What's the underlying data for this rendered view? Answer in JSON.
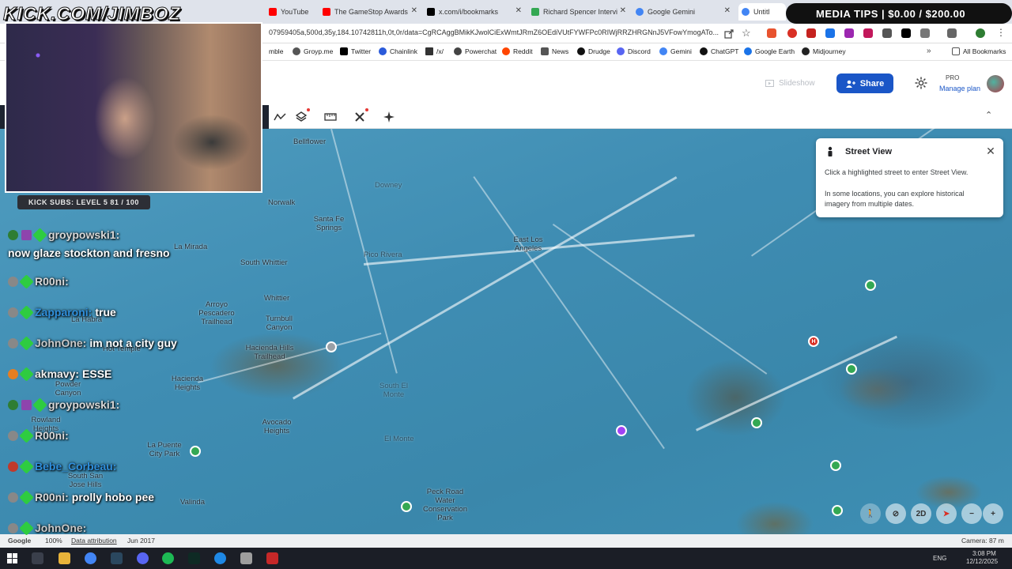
{
  "stream": {
    "watermark": "KICK.COM/JIMBOZ",
    "media_tips": "MEDIA TIPS | $0.00 / $200.00",
    "subs_bar": "KICK SUBS: LEVEL 5 81 / 100",
    "chat": [
      {
        "name": "groypowski1:",
        "msg": "",
        "color": "#d8d8d8"
      },
      {
        "name": "",
        "msg": "now glaze stockton and fresno",
        "color": "#ffffff"
      },
      {
        "name": "R00ni:",
        "msg": "",
        "color": "#d8d8d8"
      },
      {
        "name": "Zapparoni:",
        "msg": "true",
        "color": "#2f8fdc"
      },
      {
        "name": "JohnOne:",
        "msg": "im not a city guy",
        "color": "#c9c9c9"
      },
      {
        "name": "akmavy:",
        "msg": "ESSE",
        "color": "#f0f0f0"
      },
      {
        "name": "groypowski1:",
        "msg": "",
        "color": "#d8d8d8"
      },
      {
        "name": "R00ni:",
        "msg": "",
        "color": "#d8d8d8"
      },
      {
        "name": "Bebe_Corbeau:",
        "msg": "",
        "color": "#2f8fdc"
      },
      {
        "name": "R00ni:",
        "msg": "prolly hobo pee",
        "color": "#d8d8d8"
      },
      {
        "name": "JohnOne:",
        "msg": "",
        "color": "#c9c9c9"
      }
    ]
  },
  "browser": {
    "tabs": [
      {
        "label": "YouTube",
        "color": "#ff0000"
      },
      {
        "label": "The GameStop Awards",
        "color": "#ff0000"
      },
      {
        "label": "x.com/i/bookmarks",
        "color": "#000000"
      },
      {
        "label": "Richard Spencer Intervi",
        "color": "#34a853"
      },
      {
        "label": "Google Gemini",
        "color": "#4285f4"
      },
      {
        "label": "Untitl",
        "color": "#4285f4"
      }
    ],
    "url": "07959405a,500d,35y,184.10742811h,0t,0r/data=CgRCAggBMikKJwolCiExWmtJRmZ6OEdiVUtFYWFPc0RIWjRRZHRGNnJ5VFowYmogATo...",
    "bookmarks": [
      {
        "label": "mble",
        "color": "#888"
      },
      {
        "label": "Groyp.me",
        "color": "#555"
      },
      {
        "label": "Twitter",
        "color": "#000"
      },
      {
        "label": "Chainlink",
        "color": "#2a5ada"
      },
      {
        "label": "/x/",
        "color": "#333"
      },
      {
        "label": "Powerchat",
        "color": "#444"
      },
      {
        "label": "Reddit",
        "color": "#ff4500"
      },
      {
        "label": "News",
        "color": "#555"
      },
      {
        "label": "Drudge",
        "color": "#111"
      },
      {
        "label": "Discord",
        "color": "#5865f2"
      },
      {
        "label": "Gemini",
        "color": "#4285f4"
      },
      {
        "label": "ChatGPT",
        "color": "#111"
      },
      {
        "label": "Google Earth",
        "color": "#1a73e8"
      },
      {
        "label": "Midjourney",
        "color": "#222"
      }
    ],
    "all_bookmarks": "All Bookmarks"
  },
  "app": {
    "slideshow": "Slideshow",
    "share": "Share",
    "plan": "PRO",
    "manage_plan": "Manage plan"
  },
  "map": {
    "places": [
      {
        "text": "Bellflower"
      },
      {
        "text": "Downey"
      },
      {
        "text": "Norwalk"
      },
      {
        "text": "Santa Fe\nSprings"
      },
      {
        "text": "Pico Rivera"
      },
      {
        "text": "East Los\nAngeles"
      },
      {
        "text": "South Whittier"
      },
      {
        "text": "La Mirada"
      },
      {
        "text": "Whittier"
      },
      {
        "text": "Arroyo\nPescadero\nTrailhead"
      },
      {
        "text": "Turnbull\nCanyon"
      },
      {
        "text": "Hacienda Hills\nTrailhead"
      },
      {
        "text": "La Habra"
      },
      {
        "text": "Hacienda\nHeights"
      },
      {
        "text": "South El\nMonte"
      },
      {
        "text": "Avocado\nHeights"
      },
      {
        "text": "La Puente\nCity Park"
      },
      {
        "text": "Powder\nCanyon"
      },
      {
        "text": "Rowland\nHeights"
      },
      {
        "text": "South San\nJose Hills"
      },
      {
        "text": "Valinda"
      },
      {
        "text": "El Monte"
      },
      {
        "text": "Peck Road\nWater\nConservation\nPark"
      },
      {
        "text": "Hot Temple"
      }
    ],
    "street_view": {
      "title": "Street View",
      "line1": "Click a highlighted street to enter Street View.",
      "line2": "In some locations, you can explore historical imagery from multiple dates."
    },
    "controls": {
      "mode_2d": "2D"
    },
    "footer": {
      "google": "Google",
      "zoom": "100%",
      "attribution": "Data attribution",
      "date": "Jun 2017",
      "camera": "Camera: 87 m"
    }
  },
  "taskbar": {
    "lang": "ENG",
    "time": "3:08 PM",
    "date": "12/12/2025"
  }
}
